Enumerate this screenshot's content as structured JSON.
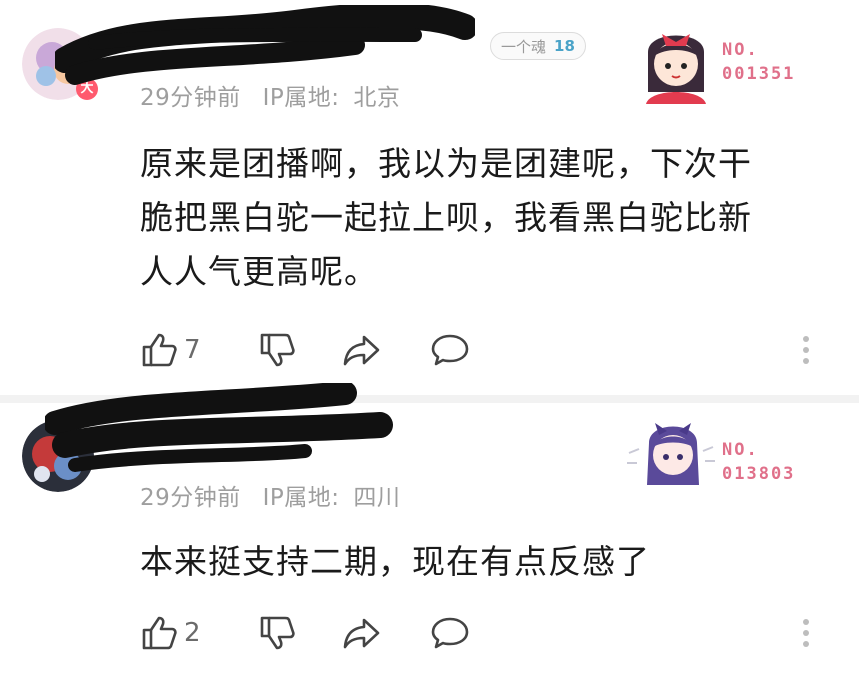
{
  "comments": [
    {
      "fan_badge": {
        "label": "一个魂",
        "level": "18"
      },
      "time": "29分钟前",
      "ip_label": "IP属地:",
      "ip_location": "北京",
      "text_lines": [
        "原来是团播啊，我以为是团建呢，下次干",
        "脆把黑白驼一起拉上呗，我看黑白驼比新",
        "人人气更高呢。"
      ],
      "likes": "7",
      "sticker": {
        "no_label": "NO.",
        "no_value": "001351"
      }
    },
    {
      "time": "29分钟前",
      "ip_label": "IP属地:",
      "ip_location": "四川",
      "text_lines": [
        "本来挺支持二期，现在有点反感了"
      ],
      "likes": "2",
      "sticker": {
        "no_label": "NO.",
        "no_value": "013803"
      }
    }
  ],
  "icons": {
    "like": "thumbs-up-icon",
    "dislike": "thumbs-down-icon",
    "share": "share-arrow-icon",
    "reply": "comment-bubble-icon",
    "more": "more-vertical-icon"
  },
  "colors": {
    "meta_gray": "#9e9e9e",
    "icon_gray": "#444444",
    "sticker_pink": "#e0708a",
    "badge_level_blue": "#4aa3c8"
  }
}
